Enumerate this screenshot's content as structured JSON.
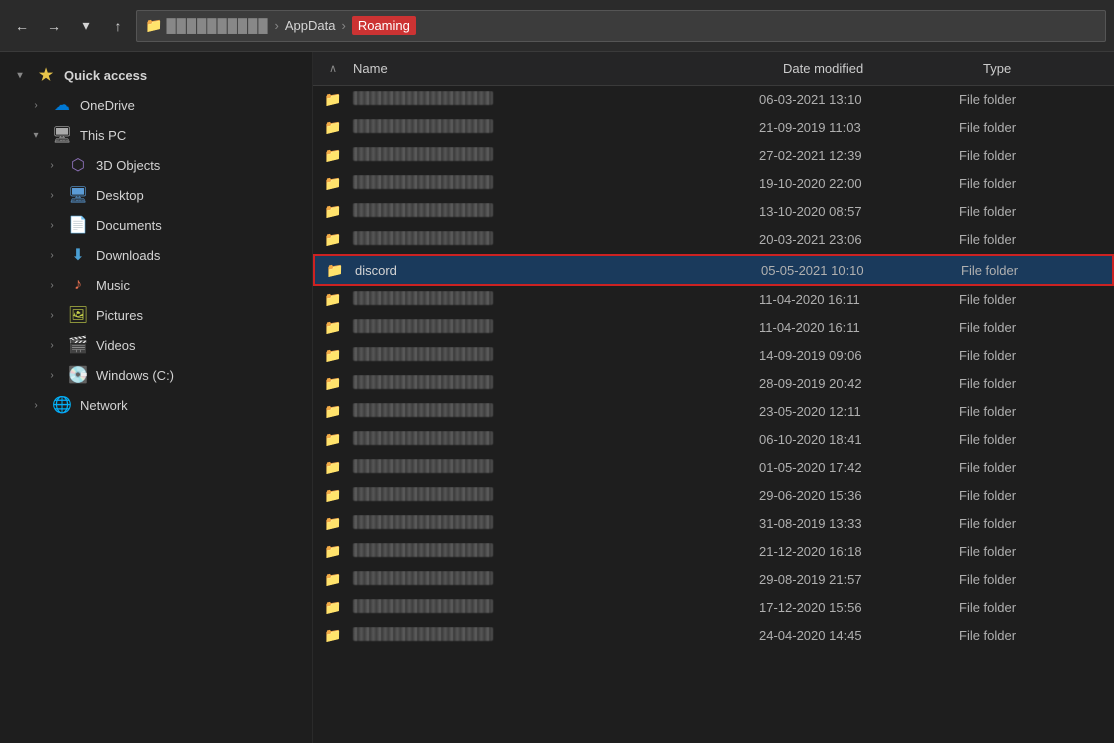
{
  "titlebar": {
    "back_btn": "←",
    "forward_btn": "→",
    "dropdown_btn": "▾",
    "up_btn": "↑",
    "address": {
      "folder_icon": "📁",
      "hidden_part": "██████████",
      "separator1": "›",
      "appdata": "AppData",
      "separator2": "›",
      "current": "Roaming"
    }
  },
  "columns": {
    "up_arrow": "∧",
    "name": "Name",
    "date_modified": "Date modified",
    "type": "Type"
  },
  "sidebar": {
    "quick_access": {
      "label": "Quick access",
      "arrow": "▾",
      "icon": "★"
    },
    "onedrive": {
      "label": "OneDrive",
      "arrow": "›"
    },
    "this_pc": {
      "label": "This PC",
      "arrow": "▾"
    },
    "items": [
      {
        "id": "3d-objects",
        "label": "3D Objects",
        "arrow": "›"
      },
      {
        "id": "desktop",
        "label": "Desktop",
        "arrow": "›"
      },
      {
        "id": "documents",
        "label": "Documents",
        "arrow": "›"
      },
      {
        "id": "downloads",
        "label": "Downloads",
        "arrow": "›"
      },
      {
        "id": "music",
        "label": "Music",
        "arrow": "›"
      },
      {
        "id": "pictures",
        "label": "Pictures",
        "arrow": "›"
      },
      {
        "id": "videos",
        "label": "Videos",
        "arrow": "›"
      },
      {
        "id": "windows",
        "label": "Windows (C:)",
        "arrow": "›"
      }
    ],
    "network": {
      "label": "Network",
      "arrow": "›"
    }
  },
  "files": [
    {
      "name": null,
      "date": "06-03-2021 13:10",
      "type": "File folder",
      "highlighted": false
    },
    {
      "name": null,
      "date": "21-09-2019 11:03",
      "type": "File folder",
      "highlighted": false
    },
    {
      "name": null,
      "date": "27-02-2021 12:39",
      "type": "File folder",
      "highlighted": false
    },
    {
      "name": null,
      "date": "19-10-2020 22:00",
      "type": "File folder",
      "highlighted": false
    },
    {
      "name": null,
      "date": "13-10-2020 08:57",
      "type": "File folder",
      "highlighted": false
    },
    {
      "name": null,
      "date": "20-03-2021 23:06",
      "type": "File folder",
      "highlighted": false
    },
    {
      "name": "discord",
      "date": "05-05-2021 10:10",
      "type": "File folder",
      "highlighted": true
    },
    {
      "name": null,
      "date": "11-04-2020 16:11",
      "type": "File folder",
      "highlighted": false
    },
    {
      "name": null,
      "date": "11-04-2020 16:11",
      "type": "File folder",
      "highlighted": false
    },
    {
      "name": null,
      "date": "14-09-2019 09:06",
      "type": "File folder",
      "highlighted": false
    },
    {
      "name": null,
      "date": "28-09-2019 20:42",
      "type": "File folder",
      "highlighted": false
    },
    {
      "name": null,
      "date": "23-05-2020 12:11",
      "type": "File folder",
      "highlighted": false
    },
    {
      "name": null,
      "date": "06-10-2020 18:41",
      "type": "File folder",
      "highlighted": false
    },
    {
      "name": null,
      "date": "01-05-2020 17:42",
      "type": "File folder",
      "highlighted": false
    },
    {
      "name": null,
      "date": "29-06-2020 15:36",
      "type": "File folder",
      "highlighted": false
    },
    {
      "name": null,
      "date": "31-08-2019 13:33",
      "type": "File folder",
      "highlighted": false
    },
    {
      "name": null,
      "date": "21-12-2020 16:18",
      "type": "File folder",
      "highlighted": false
    },
    {
      "name": null,
      "date": "29-08-2019 21:57",
      "type": "File folder",
      "highlighted": false
    },
    {
      "name": null,
      "date": "17-12-2020 15:56",
      "type": "File folder",
      "highlighted": false
    },
    {
      "name": null,
      "date": "24-04-2020 14:45",
      "type": "File folder",
      "highlighted": false
    }
  ]
}
